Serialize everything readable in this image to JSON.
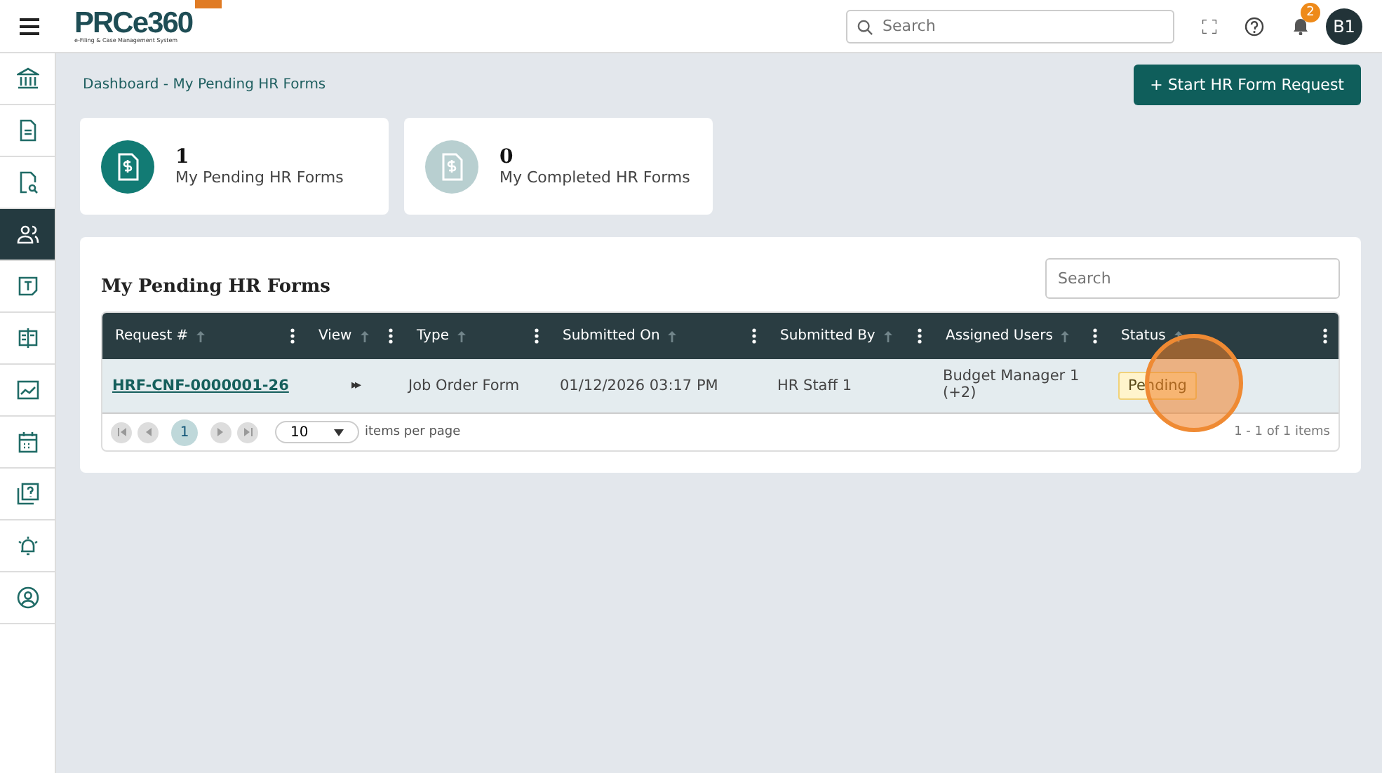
{
  "header": {
    "logo": "PRCe360",
    "logo_tagline": "e-Filing & Case Management System",
    "search": {
      "placeholder": "Search"
    },
    "notification_count": "2",
    "avatar": "B1"
  },
  "sidebar": {
    "items": [
      {
        "selected": false
      },
      {
        "selected": false
      },
      {
        "selected": false
      },
      {
        "selected": true
      },
      {
        "selected": false
      },
      {
        "selected": false
      },
      {
        "selected": false
      },
      {
        "selected": false
      },
      {
        "selected": false
      },
      {
        "selected": false
      },
      {
        "selected": false
      }
    ]
  },
  "breadcrumb": "Dashboard - My Pending HR Forms",
  "primary_button": "+ Start HR Form Request",
  "stat_cards": [
    {
      "count": "1",
      "label": "My Pending HR Forms",
      "active": true
    },
    {
      "count": "0",
      "label": "My Completed HR Forms",
      "active": false
    }
  ],
  "panel": {
    "title": "My Pending HR Forms",
    "search": {
      "placeholder": "Search"
    },
    "table": {
      "columns": [
        "Request #",
        "View",
        "Type",
        "Submitted On",
        "Submitted By",
        "Assigned Users",
        "Status"
      ],
      "rows": [
        {
          "request": "HRF-CNF-0000001-26",
          "view": "▸▸",
          "type": "Job Order Form",
          "submitted_on": "01/12/2026 03:17 PM",
          "submitted_by": "HR Staff 1",
          "assigned_users": "Budget Manager 1 (+2)",
          "status": "Pending"
        }
      ]
    },
    "pager": {
      "pages": [
        {
          "label": "1",
          "selected": true
        }
      ],
      "page_size": "10",
      "page_size_label": "items per page",
      "info": "1 - 1 of 1 items"
    }
  }
}
